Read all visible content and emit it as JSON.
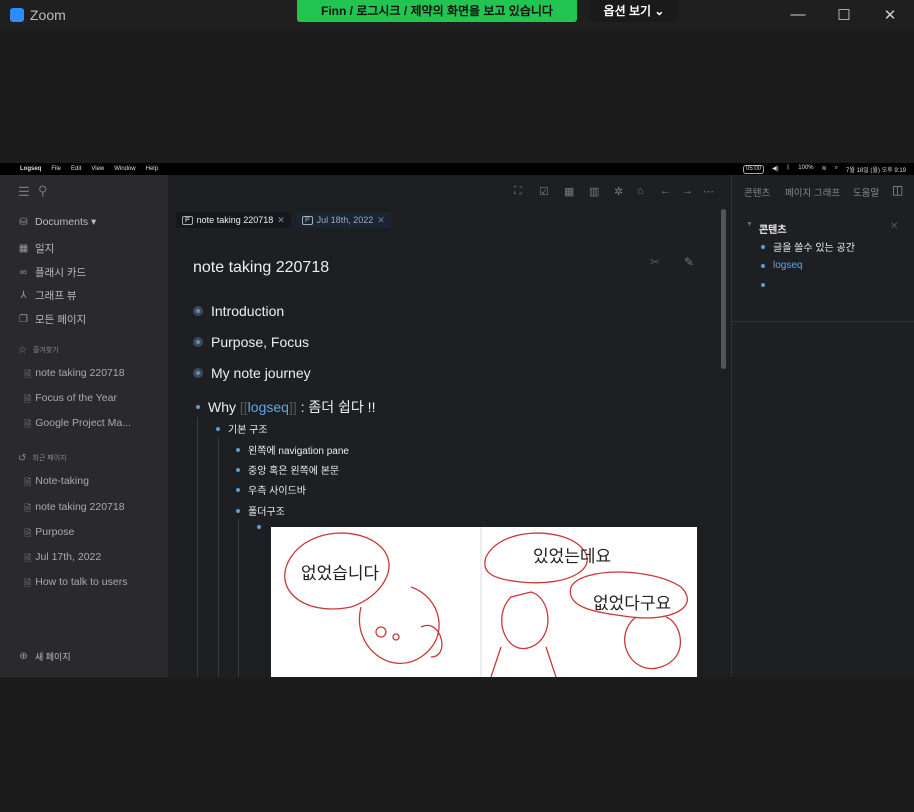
{
  "zoom": {
    "title": "Zoom",
    "banner": "Finn / 로그시크 / 제약의 화면을 보고 있습니다",
    "options": "옵션 보기 ⌄"
  },
  "mac": {
    "menu": [
      "Logseq",
      "File",
      "Edit",
      "View",
      "Window",
      "Help"
    ],
    "timer": "05:00",
    "battery": "100%",
    "datetime": "7월 18일 (월) 오후 9:19"
  },
  "sidebar": {
    "nav": [
      {
        "icon": "database-icon",
        "label": "Documents ▾"
      },
      {
        "icon": "calendar-icon",
        "label": "일지"
      },
      {
        "icon": "flashcard-icon",
        "label": "플래시 카드"
      },
      {
        "icon": "graph-icon",
        "label": "그래프 뷰"
      },
      {
        "icon": "pages-icon",
        "label": "모든 페이지"
      }
    ],
    "favorites_label": "즐겨찾기",
    "favorites": [
      "note taking 220718",
      "Focus of the Year",
      "Google Project Ma..."
    ],
    "recent_label": "최근 페이지",
    "recent": [
      "Note-taking",
      "note taking 220718",
      "Purpose",
      "Jul 17th, 2022",
      "How to talk to users"
    ],
    "new_page": "새 페이지"
  },
  "tabs": [
    {
      "label": "note taking 220718"
    },
    {
      "label": "Jul 18th, 2022"
    }
  ],
  "page": {
    "title": "note taking 220718",
    "blocks": [
      "Introduction",
      "Purpose, Focus",
      "My note journey"
    ],
    "why": {
      "prefix": "Why ",
      "link": "logseq",
      "suffix": " : 좀더 쉽다 !!"
    },
    "sub": "기본 구조",
    "subsub": [
      "왼쪽에 navigation pane",
      "중앙 혹은 왼쪽에 본문",
      "우측 사이드바",
      "폴더구조"
    ],
    "drawing_text": [
      "없었습니다",
      "있었는데요",
      "없었다구요"
    ]
  },
  "right": {
    "tabs": [
      "콘텐츠",
      "페이지 그래프",
      "도움말"
    ],
    "heading": "콘텐츠",
    "items": [
      "글을 쓸수 있는 공간",
      "logseq"
    ]
  }
}
